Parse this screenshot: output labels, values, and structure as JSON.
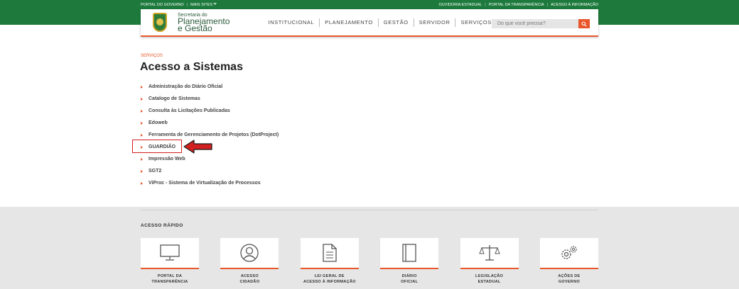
{
  "topbar": {
    "portal_governo": "PORTAL DO GOVERNO",
    "mais_sites": "MAIS SITES",
    "ouvidoria": "OUVIDORIA ESTADUAL",
    "portal_transparencia": "PORTAL DA TRANSPARÊNCIA",
    "acesso_informacao": "ACESSO À INFORMAÇÃO"
  },
  "header": {
    "brand_small": "Secretaria do",
    "brand_line1": "Planejamento",
    "brand_line2": "e Gestão",
    "nav": [
      "INSTITUCIONAL",
      "PLANEJAMENTO",
      "GESTÃO",
      "SERVIDOR",
      "SERVIÇOS"
    ],
    "search_placeholder": "Do que você precisa?"
  },
  "main": {
    "breadcrumb": "SERVIÇOS",
    "title": "Acesso a Sistemas",
    "items": [
      "Administração do Diário Oficial",
      "Catalogo de Sistemas",
      "Consulta às Licitações Publicadas",
      "Edoweb",
      "Ferramenta de Gerenciamento de Projetos (DotProject)",
      "GUARDIÃO",
      "Impressão Web",
      "SGT2",
      "ViProc - Sistema de Virtualização de Processos"
    ]
  },
  "footer": {
    "title": "ACESSO RÁPIDO",
    "cards": [
      {
        "label": "PORTAL DA\nTRANSPARÊNCIA",
        "icon": "monitor-icon"
      },
      {
        "label": "ACESSO\nCIDADÃO",
        "icon": "user-circle-icon"
      },
      {
        "label": "LEI GERAL DE\nACESSO À INFORMAÇÃO",
        "icon": "document-icon"
      },
      {
        "label": "DIÁRIO\nOFICIAL",
        "icon": "book-icon"
      },
      {
        "label": "LEGISLAÇÃO\nESTADUAL",
        "icon": "scales-icon"
      },
      {
        "label": "AÇÕES DE\nGOVERNO",
        "icon": "gears-icon"
      }
    ]
  },
  "colors": {
    "green": "#1d7a3c",
    "orange": "#e8562a",
    "highlight_red": "#d22020"
  }
}
